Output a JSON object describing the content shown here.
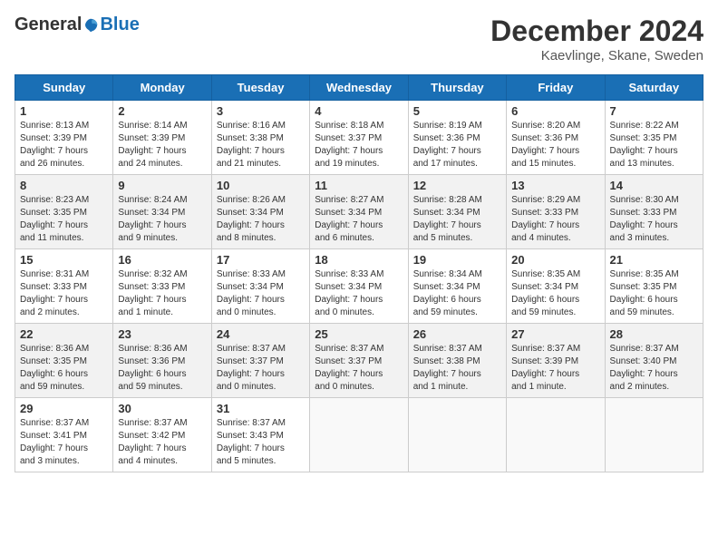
{
  "header": {
    "logo_general": "General",
    "logo_blue": "Blue",
    "month_title": "December 2024",
    "subtitle": "Kaevlinge, Skane, Sweden"
  },
  "days_of_week": [
    "Sunday",
    "Monday",
    "Tuesday",
    "Wednesday",
    "Thursday",
    "Friday",
    "Saturday"
  ],
  "weeks": [
    [
      {
        "day": "1",
        "info": "Sunrise: 8:13 AM\nSunset: 3:39 PM\nDaylight: 7 hours\nand 26 minutes."
      },
      {
        "day": "2",
        "info": "Sunrise: 8:14 AM\nSunset: 3:39 PM\nDaylight: 7 hours\nand 24 minutes."
      },
      {
        "day": "3",
        "info": "Sunrise: 8:16 AM\nSunset: 3:38 PM\nDaylight: 7 hours\nand 21 minutes."
      },
      {
        "day": "4",
        "info": "Sunrise: 8:18 AM\nSunset: 3:37 PM\nDaylight: 7 hours\nand 19 minutes."
      },
      {
        "day": "5",
        "info": "Sunrise: 8:19 AM\nSunset: 3:36 PM\nDaylight: 7 hours\nand 17 minutes."
      },
      {
        "day": "6",
        "info": "Sunrise: 8:20 AM\nSunset: 3:36 PM\nDaylight: 7 hours\nand 15 minutes."
      },
      {
        "day": "7",
        "info": "Sunrise: 8:22 AM\nSunset: 3:35 PM\nDaylight: 7 hours\nand 13 minutes."
      }
    ],
    [
      {
        "day": "8",
        "info": "Sunrise: 8:23 AM\nSunset: 3:35 PM\nDaylight: 7 hours\nand 11 minutes."
      },
      {
        "day": "9",
        "info": "Sunrise: 8:24 AM\nSunset: 3:34 PM\nDaylight: 7 hours\nand 9 minutes."
      },
      {
        "day": "10",
        "info": "Sunrise: 8:26 AM\nSunset: 3:34 PM\nDaylight: 7 hours\nand 8 minutes."
      },
      {
        "day": "11",
        "info": "Sunrise: 8:27 AM\nSunset: 3:34 PM\nDaylight: 7 hours\nand 6 minutes."
      },
      {
        "day": "12",
        "info": "Sunrise: 8:28 AM\nSunset: 3:34 PM\nDaylight: 7 hours\nand 5 minutes."
      },
      {
        "day": "13",
        "info": "Sunrise: 8:29 AM\nSunset: 3:33 PM\nDaylight: 7 hours\nand 4 minutes."
      },
      {
        "day": "14",
        "info": "Sunrise: 8:30 AM\nSunset: 3:33 PM\nDaylight: 7 hours\nand 3 minutes."
      }
    ],
    [
      {
        "day": "15",
        "info": "Sunrise: 8:31 AM\nSunset: 3:33 PM\nDaylight: 7 hours\nand 2 minutes."
      },
      {
        "day": "16",
        "info": "Sunrise: 8:32 AM\nSunset: 3:33 PM\nDaylight: 7 hours\nand 1 minute."
      },
      {
        "day": "17",
        "info": "Sunrise: 8:33 AM\nSunset: 3:34 PM\nDaylight: 7 hours\nand 0 minutes."
      },
      {
        "day": "18",
        "info": "Sunrise: 8:33 AM\nSunset: 3:34 PM\nDaylight: 7 hours\nand 0 minutes."
      },
      {
        "day": "19",
        "info": "Sunrise: 8:34 AM\nSunset: 3:34 PM\nDaylight: 6 hours\nand 59 minutes."
      },
      {
        "day": "20",
        "info": "Sunrise: 8:35 AM\nSunset: 3:34 PM\nDaylight: 6 hours\nand 59 minutes."
      },
      {
        "day": "21",
        "info": "Sunrise: 8:35 AM\nSunset: 3:35 PM\nDaylight: 6 hours\nand 59 minutes."
      }
    ],
    [
      {
        "day": "22",
        "info": "Sunrise: 8:36 AM\nSunset: 3:35 PM\nDaylight: 6 hours\nand 59 minutes."
      },
      {
        "day": "23",
        "info": "Sunrise: 8:36 AM\nSunset: 3:36 PM\nDaylight: 6 hours\nand 59 minutes."
      },
      {
        "day": "24",
        "info": "Sunrise: 8:37 AM\nSunset: 3:37 PM\nDaylight: 7 hours\nand 0 minutes."
      },
      {
        "day": "25",
        "info": "Sunrise: 8:37 AM\nSunset: 3:37 PM\nDaylight: 7 hours\nand 0 minutes."
      },
      {
        "day": "26",
        "info": "Sunrise: 8:37 AM\nSunset: 3:38 PM\nDaylight: 7 hours\nand 1 minute."
      },
      {
        "day": "27",
        "info": "Sunrise: 8:37 AM\nSunset: 3:39 PM\nDaylight: 7 hours\nand 1 minute."
      },
      {
        "day": "28",
        "info": "Sunrise: 8:37 AM\nSunset: 3:40 PM\nDaylight: 7 hours\nand 2 minutes."
      }
    ],
    [
      {
        "day": "29",
        "info": "Sunrise: 8:37 AM\nSunset: 3:41 PM\nDaylight: 7 hours\nand 3 minutes."
      },
      {
        "day": "30",
        "info": "Sunrise: 8:37 AM\nSunset: 3:42 PM\nDaylight: 7 hours\nand 4 minutes."
      },
      {
        "day": "31",
        "info": "Sunrise: 8:37 AM\nSunset: 3:43 PM\nDaylight: 7 hours\nand 5 minutes."
      },
      {
        "day": "",
        "info": ""
      },
      {
        "day": "",
        "info": ""
      },
      {
        "day": "",
        "info": ""
      },
      {
        "day": "",
        "info": ""
      }
    ]
  ]
}
